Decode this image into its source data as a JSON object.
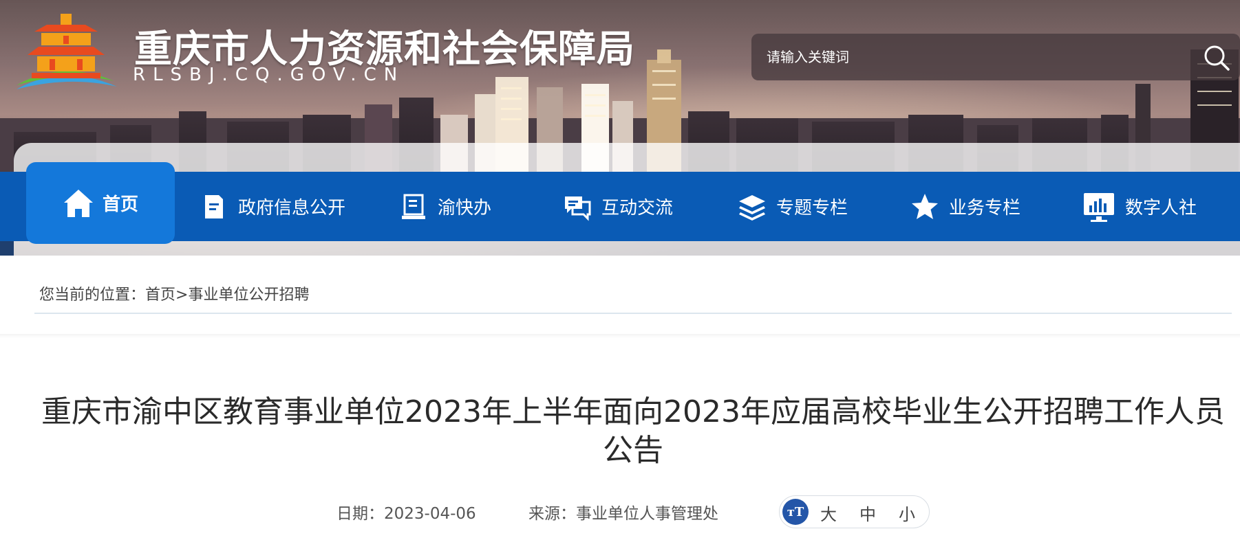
{
  "header": {
    "site_title": "重庆市人力资源和社会保障局",
    "site_domain": "RLSBJ.CQ.GOV.CN",
    "search_placeholder": "请输入关键词"
  },
  "nav": {
    "items": [
      {
        "label": "首页",
        "icon": "home-icon",
        "active": true
      },
      {
        "label": "政府信息公开",
        "icon": "document-icon"
      },
      {
        "label": "渝快办",
        "icon": "clipboard-icon"
      },
      {
        "label": "互动交流",
        "icon": "chat-icon"
      },
      {
        "label": "专题专栏",
        "icon": "layers-icon"
      },
      {
        "label": "业务专栏",
        "icon": "star-icon"
      },
      {
        "label": "数字人社",
        "icon": "monitor-chart-icon"
      }
    ]
  },
  "breadcrumb": {
    "prefix": "您当前的位置：",
    "home": "首页",
    "separator": ">",
    "current": "事业单位公开招聘"
  },
  "article": {
    "title": "重庆市渝中区教育事业单位2023年上半年面向2023年应届高校毕业生公开招聘工作人员公告",
    "date_label": "日期：",
    "date_value": "2023-04-06",
    "source_label": "来源：",
    "source_value": "事业单位人事管理处",
    "font_icon_text": "тT",
    "font_sizes": [
      "大",
      "中",
      "小"
    ]
  },
  "colors": {
    "nav_bg": "#0a5bb5",
    "nav_active_bg": "#1478da",
    "font_icon_bg": "#2456a8"
  }
}
